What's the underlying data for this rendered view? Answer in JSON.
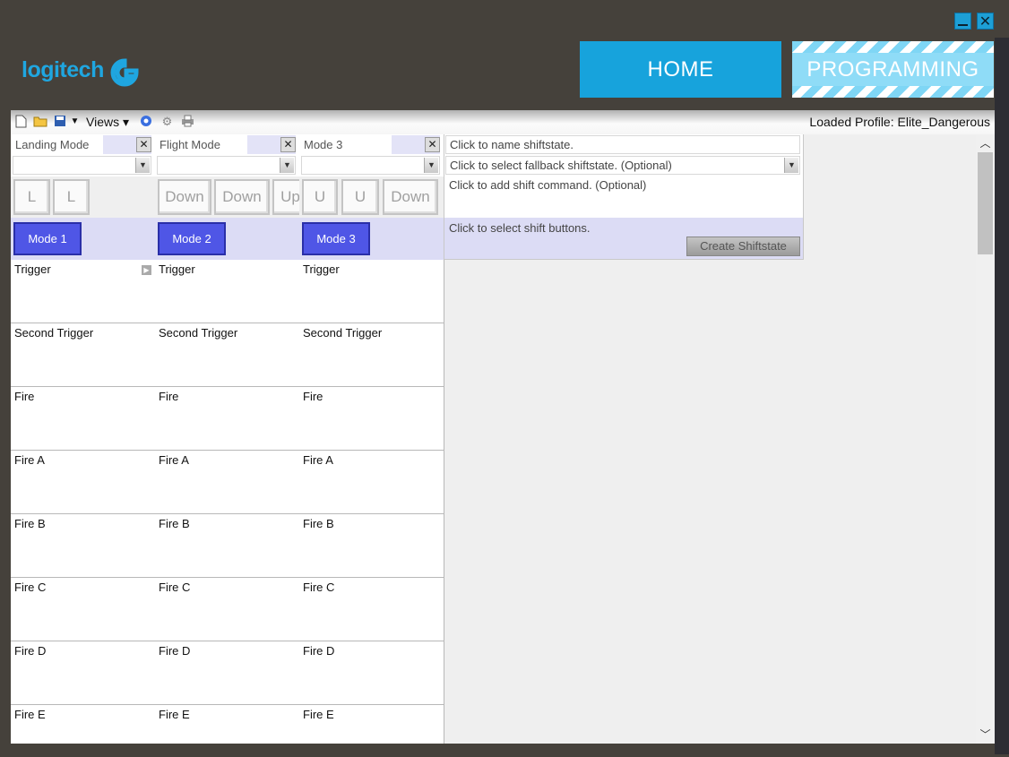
{
  "window": {
    "close_glyph": "✕"
  },
  "brand": {
    "logo_text": "logitech",
    "accent": "#1fa6e0"
  },
  "nav": {
    "home_label": "HOME",
    "programming_label": "PROGRAMMING"
  },
  "toolbar": {
    "views_label": "Views ▾",
    "loaded_profile": "Loaded Profile: Elite_Dangerous",
    "icons": [
      "new-file-icon",
      "open-folder-icon",
      "save-icon",
      "dropdown-icon",
      "help-icon",
      "gear-icon",
      "print-icon"
    ]
  },
  "columns": [
    {
      "mode_name": "Landing Mode",
      "keys": [
        "L",
        "L"
      ],
      "mode_button": "Mode 1",
      "has_arrow": true
    },
    {
      "mode_name": "Flight Mode",
      "keys": [
        "Down",
        "Down",
        "Up"
      ],
      "mode_button": "Mode 2",
      "has_arrow": false
    },
    {
      "mode_name": "Mode 3",
      "keys": [
        "U",
        "U",
        "Down"
      ],
      "mode_button": "Mode 3",
      "has_arrow": false
    }
  ],
  "row_labels": [
    "Trigger",
    "Second Trigger",
    "Fire",
    "Fire A",
    "Fire B",
    "Fire C",
    "Fire D",
    "Fire E"
  ],
  "shiftstate": {
    "name_placeholder": "Click to name shiftstate.",
    "fallback_placeholder": "Click to select fallback shiftstate. (Optional)",
    "command_placeholder": "Click to add shift command. (Optional)",
    "buttons_placeholder": "Click to select shift buttons.",
    "create_label": "Create Shiftstate"
  }
}
